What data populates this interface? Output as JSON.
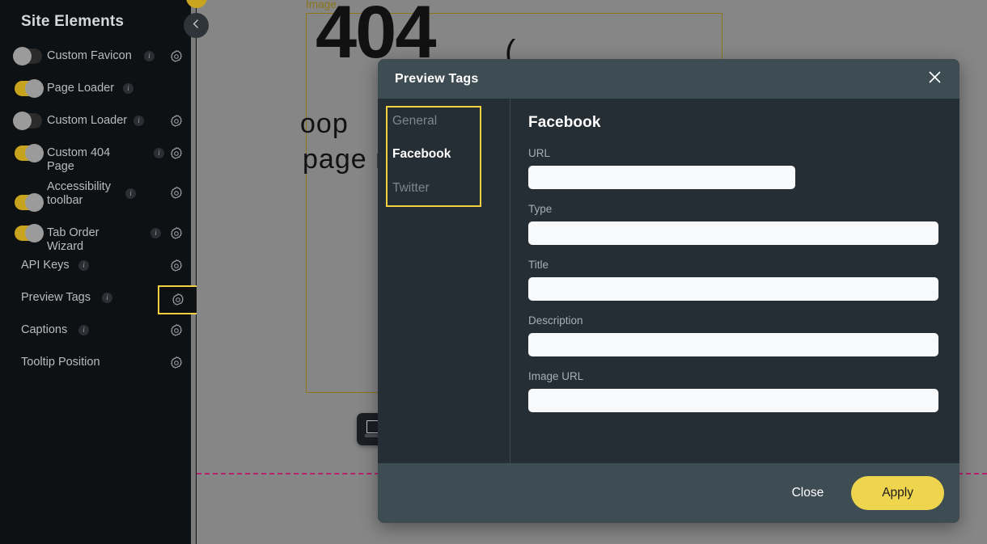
{
  "canvas": {
    "image_block_label": "Image",
    "error_code": "404",
    "error_quote": "(",
    "error_line1": "oop",
    "error_line2": "page no",
    "widget_icon": "image-placeholder-icon",
    "fold_line_color": "#b4216e"
  },
  "sidebar": {
    "title": "Site Elements",
    "collapse_icon": "chevron-left-icon",
    "info_badge_label": "i",
    "gear_icon": "gear-icon",
    "items": [
      {
        "label": "Custom Favicon",
        "toggle": "off",
        "has_toggle": true,
        "has_info": true,
        "has_gear": true,
        "highlighted": false
      },
      {
        "label": "Page Loader",
        "toggle": "on",
        "has_toggle": true,
        "has_info": true,
        "has_gear": false,
        "highlighted": false
      },
      {
        "label": "Custom Loader",
        "toggle": "off",
        "has_toggle": true,
        "has_info": true,
        "has_gear": true,
        "highlighted": false
      },
      {
        "label": "Custom 404 Page",
        "toggle": "on",
        "has_toggle": true,
        "has_info": true,
        "has_gear": true,
        "highlighted": false
      },
      {
        "label": "Accessibility toolbar",
        "toggle": "on",
        "has_toggle": true,
        "has_info": true,
        "has_gear": true,
        "highlighted": false
      },
      {
        "label": "Tab Order Wizard",
        "toggle": "on",
        "has_toggle": true,
        "has_info": true,
        "has_gear": true,
        "highlighted": false
      },
      {
        "label": "API Keys",
        "toggle": null,
        "has_toggle": false,
        "has_info": true,
        "has_gear": true,
        "highlighted": false
      },
      {
        "label": "Preview Tags",
        "toggle": null,
        "has_toggle": false,
        "has_info": true,
        "has_gear": true,
        "highlighted": true
      },
      {
        "label": "Captions",
        "toggle": null,
        "has_toggle": false,
        "has_info": true,
        "has_gear": true,
        "highlighted": false
      },
      {
        "label": "Tooltip Position",
        "toggle": null,
        "has_toggle": false,
        "has_info": false,
        "has_gear": true,
        "highlighted": false
      }
    ]
  },
  "modal": {
    "title": "Preview Tags",
    "close_icon": "close-icon",
    "tabs": [
      {
        "label": "General",
        "active": false
      },
      {
        "label": "Facebook",
        "active": true
      },
      {
        "label": "Twitter",
        "active": false
      }
    ],
    "form": {
      "heading": "Facebook",
      "fields": [
        {
          "label": "URL",
          "value": "",
          "placeholder": "",
          "narrow": true
        },
        {
          "label": "Type",
          "value": "",
          "placeholder": "",
          "narrow": false
        },
        {
          "label": "Title",
          "value": "",
          "placeholder": "",
          "narrow": false
        },
        {
          "label": "Description",
          "value": "",
          "placeholder": "",
          "narrow": false
        },
        {
          "label": "Image URL",
          "value": "",
          "placeholder": "",
          "narrow": false
        }
      ]
    },
    "footer": {
      "close_label": "Close",
      "apply_label": "Apply"
    }
  },
  "colors": {
    "accent_yellow": "#efd54e",
    "toggle_on": "#c8a41e",
    "modal_header": "#3e4d53",
    "modal_body": "#252d35",
    "sidebar_bg": "#0e1114",
    "highlight_border": "#f3d03e"
  }
}
